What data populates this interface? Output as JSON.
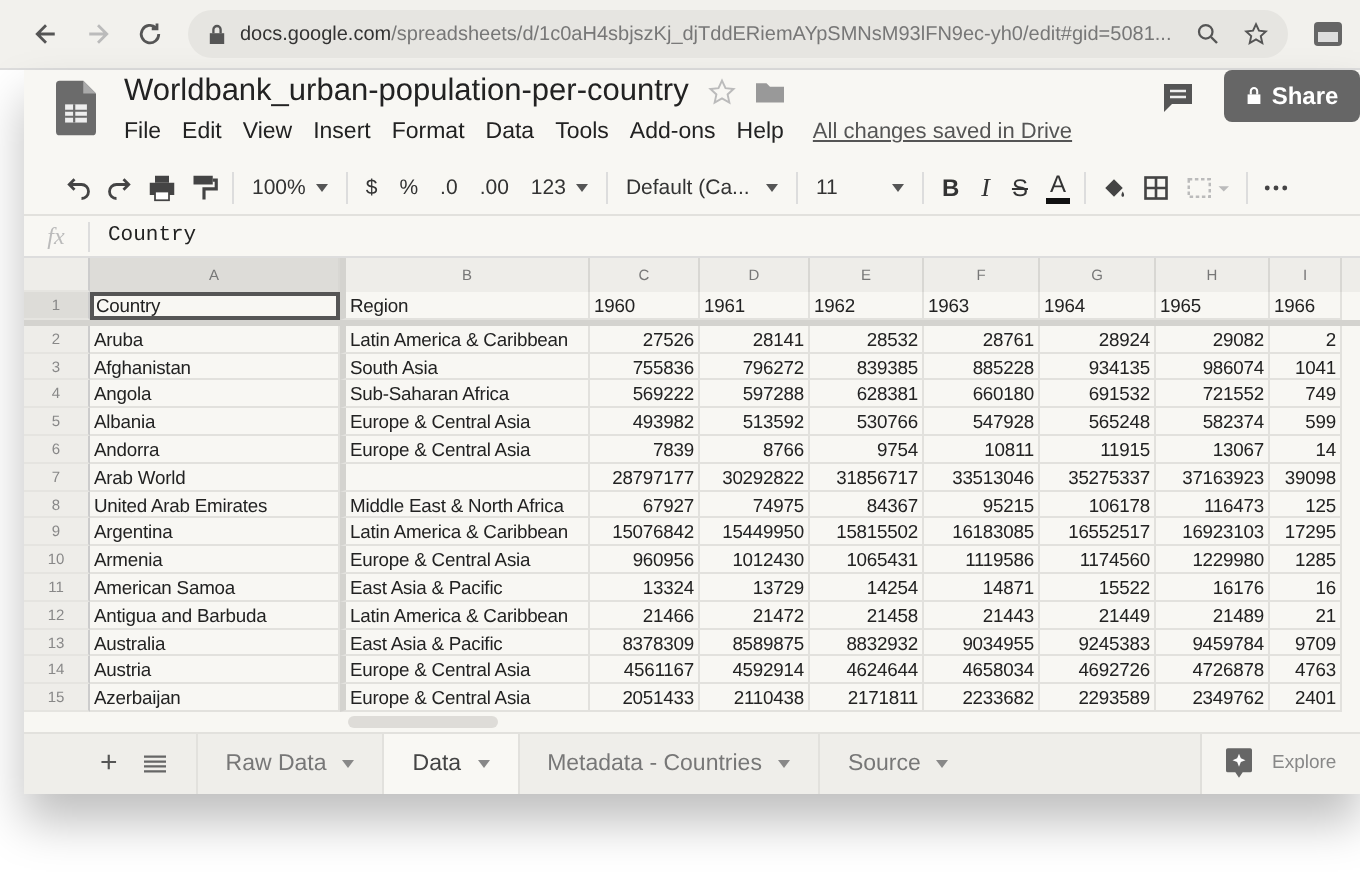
{
  "browser": {
    "url_host": "docs.google.com",
    "url_path": "/spreadsheets/d/1c0aH4sbjszKj_djTddERiemAYpSMNsM93lFN9ec-yh0/edit#gid=5081..."
  },
  "document": {
    "title": "Worldbank_urban-population-per-country",
    "menus": [
      "File",
      "Edit",
      "View",
      "Insert",
      "Format",
      "Data",
      "Tools",
      "Add-ons",
      "Help"
    ],
    "save_status": "All changes saved in Drive",
    "share": "Share"
  },
  "toolbar": {
    "zoom": "100%",
    "currency": "$",
    "percent": "%",
    "decrease_decimals": ".0",
    "increase_decimals": ".00",
    "more_formats": "123",
    "font": "Default (Ca...",
    "font_size": "11",
    "text_color_letter": "A",
    "bold": "B",
    "italic": "I",
    "strikethrough": "S"
  },
  "formula_bar": {
    "label": "fx",
    "value": "Country"
  },
  "columns": [
    {
      "letter": "A",
      "selected": true
    },
    {
      "letter": "B",
      "selected": false
    },
    {
      "letter": "C",
      "selected": false
    },
    {
      "letter": "D",
      "selected": false
    },
    {
      "letter": "E",
      "selected": false
    },
    {
      "letter": "F",
      "selected": false
    },
    {
      "letter": "G",
      "selected": false
    },
    {
      "letter": "H",
      "selected": false
    },
    {
      "letter": "I",
      "selected": false
    }
  ],
  "rows": [
    {
      "number": "1",
      "selected": true,
      "cells": [
        "Country",
        "Region",
        "1960",
        "1961",
        "1962",
        "1963",
        "1964",
        "1965",
        "1966"
      ]
    },
    {
      "number": "2",
      "selected": false,
      "cells": [
        "Aruba",
        "Latin America & Caribbean",
        "27526",
        "28141",
        "28532",
        "28761",
        "28924",
        "29082",
        "2"
      ]
    },
    {
      "number": "3",
      "selected": false,
      "cells": [
        "Afghanistan",
        "South Asia",
        "755836",
        "796272",
        "839385",
        "885228",
        "934135",
        "986074",
        "1041"
      ]
    },
    {
      "number": "4",
      "selected": false,
      "cells": [
        "Angola",
        "Sub-Saharan Africa",
        "569222",
        "597288",
        "628381",
        "660180",
        "691532",
        "721552",
        "749"
      ]
    },
    {
      "number": "5",
      "selected": false,
      "cells": [
        "Albania",
        "Europe & Central Asia",
        "493982",
        "513592",
        "530766",
        "547928",
        "565248",
        "582374",
        "599"
      ]
    },
    {
      "number": "6",
      "selected": false,
      "cells": [
        "Andorra",
        "Europe & Central Asia",
        "7839",
        "8766",
        "9754",
        "10811",
        "11915",
        "13067",
        "14"
      ]
    },
    {
      "number": "7",
      "selected": false,
      "cells": [
        "Arab World",
        "",
        "28797177",
        "30292822",
        "31856717",
        "33513046",
        "35275337",
        "37163923",
        "39098"
      ]
    },
    {
      "number": "8",
      "selected": false,
      "cells": [
        "United Arab Emirates",
        "Middle East & North Africa",
        "67927",
        "74975",
        "84367",
        "95215",
        "106178",
        "116473",
        "125"
      ]
    },
    {
      "number": "9",
      "selected": false,
      "cells": [
        "Argentina",
        "Latin America & Caribbean",
        "15076842",
        "15449950",
        "15815502",
        "16183085",
        "16552517",
        "16923103",
        "17295"
      ]
    },
    {
      "number": "10",
      "selected": false,
      "cells": [
        "Armenia",
        "Europe & Central Asia",
        "960956",
        "1012430",
        "1065431",
        "1119586",
        "1174560",
        "1229980",
        "1285"
      ]
    },
    {
      "number": "11",
      "selected": false,
      "cells": [
        "American Samoa",
        "East Asia & Pacific",
        "13324",
        "13729",
        "14254",
        "14871",
        "15522",
        "16176",
        "16"
      ]
    },
    {
      "number": "12",
      "selected": false,
      "cells": [
        "Antigua and Barbuda",
        "Latin America & Caribbean",
        "21466",
        "21472",
        "21458",
        "21443",
        "21449",
        "21489",
        "21"
      ]
    },
    {
      "number": "13",
      "selected": false,
      "cells": [
        "Australia",
        "East Asia & Pacific",
        "8378309",
        "8589875",
        "8832932",
        "9034955",
        "9245383",
        "9459784",
        "9709"
      ]
    },
    {
      "number": "14",
      "selected": false,
      "cells": [
        "Austria",
        "Europe & Central Asia",
        "4561167",
        "4592914",
        "4624644",
        "4658034",
        "4692726",
        "4726878",
        "4763"
      ]
    },
    {
      "number": "15",
      "selected": false,
      "cells": [
        "Azerbaijan",
        "Europe & Central Asia",
        "2051433",
        "2110438",
        "2171811",
        "2233682",
        "2293589",
        "2349762",
        "2401"
      ]
    }
  ],
  "sheet_tabs": [
    {
      "label": "Raw Data",
      "selected": false
    },
    {
      "label": "Data",
      "selected": true
    },
    {
      "label": "Metadata - Countries",
      "selected": false
    },
    {
      "label": "Source",
      "selected": false
    }
  ],
  "explore": "Explore",
  "add_sheet": "+"
}
